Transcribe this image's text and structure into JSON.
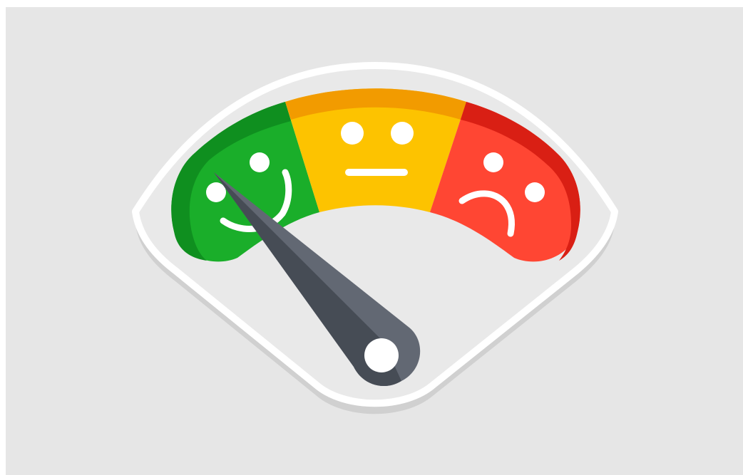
{
  "gauge": {
    "segments": [
      {
        "name": "happy",
        "color": "#1aae2a",
        "shade": "#0f8f1f"
      },
      {
        "name": "neutral",
        "color": "#fdc300",
        "shade": "#f29b00"
      },
      {
        "name": "sad",
        "color": "#ff4633",
        "shade": "#d91f14"
      }
    ],
    "needle_position": "happy",
    "colors": {
      "background": "#e6e6e6",
      "dial_face": "#e9e9e9",
      "dial_border": "#ffffff",
      "dial_shadow": "#cfcfcf",
      "needle_dark": "#464c55",
      "needle_light": "#626873",
      "hub": "#ffffff",
      "face_features": "#ffffff"
    }
  }
}
